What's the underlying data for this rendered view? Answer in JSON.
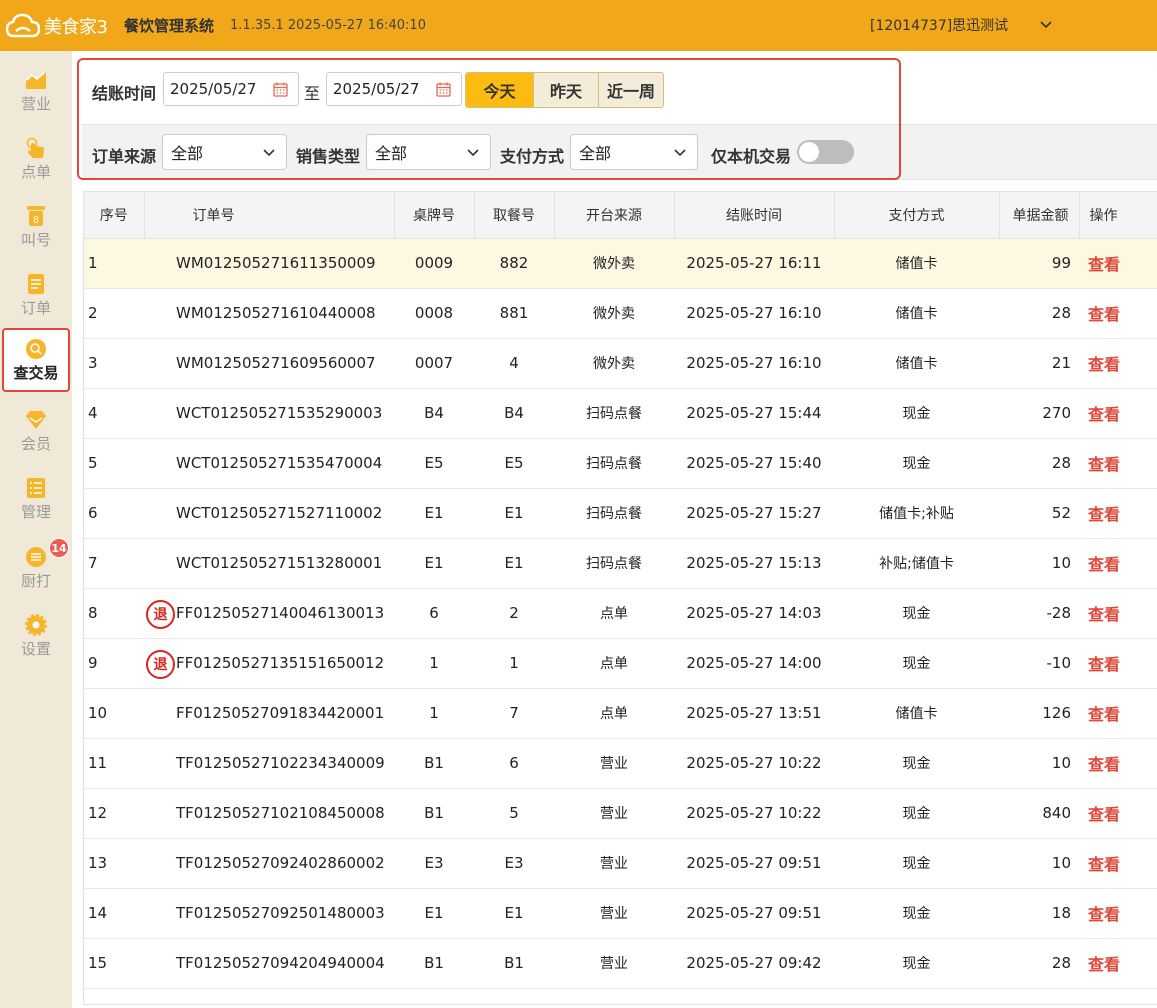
{
  "header": {
    "logo_text": "美食家3",
    "app_title": "餐饮管理系统",
    "version": "1.1.35.1 2025-05-27 16:40:10",
    "user": "[12014737]思迅测试"
  },
  "sidebar": {
    "items": [
      {
        "label": "营业",
        "icon": "chart-icon"
      },
      {
        "label": "点单",
        "icon": "hand-icon"
      },
      {
        "label": "叫号",
        "icon": "number-icon"
      },
      {
        "label": "订单",
        "icon": "list-icon"
      },
      {
        "label": "查交易",
        "icon": "search-icon",
        "active": true
      },
      {
        "label": "会员",
        "icon": "diamond-icon"
      },
      {
        "label": "管理",
        "icon": "clipboard-icon"
      },
      {
        "label": "厨打",
        "icon": "print-icon",
        "badge": "14"
      },
      {
        "label": "设置",
        "icon": "gear-icon"
      }
    ]
  },
  "filters": {
    "checkout_time_label": "结账时间",
    "date_from": "2025/05/27",
    "to_label": "至",
    "date_to": "2025/05/27",
    "quick_ranges": [
      "今天",
      "昨天",
      "近一周"
    ],
    "order_source_label": "订单来源",
    "order_source_value": "全部",
    "sale_type_label": "销售类型",
    "sale_type_value": "全部",
    "pay_method_label": "支付方式",
    "pay_method_value": "全部",
    "local_only_label": "仅本机交易",
    "local_only": false
  },
  "table": {
    "columns": [
      "序号",
      "订单号",
      "桌牌号",
      "取餐号",
      "开台来源",
      "结账时间",
      "支付方式",
      "单据金额",
      "操作"
    ],
    "action_label": "查看",
    "refund_label": "退",
    "rows": [
      {
        "no": "1",
        "order": "WM012505271611350009",
        "table": "0009",
        "pickup": "882",
        "source": "微外卖",
        "time": "2025-05-27 16:11",
        "pay": "储值卡",
        "amount": "99",
        "refund": false
      },
      {
        "no": "2",
        "order": "WM012505271610440008",
        "table": "0008",
        "pickup": "881",
        "source": "微外卖",
        "time": "2025-05-27 16:10",
        "pay": "储值卡",
        "amount": "28",
        "refund": false
      },
      {
        "no": "3",
        "order": "WM012505271609560007",
        "table": "0007",
        "pickup": "4",
        "source": "微外卖",
        "time": "2025-05-27 16:10",
        "pay": "储值卡",
        "amount": "21",
        "refund": false
      },
      {
        "no": "4",
        "order": "WCT012505271535290003",
        "table": "B4",
        "pickup": "B4",
        "source": "扫码点餐",
        "time": "2025-05-27 15:44",
        "pay": "现金",
        "amount": "270",
        "refund": false
      },
      {
        "no": "5",
        "order": "WCT012505271535470004",
        "table": "E5",
        "pickup": "E5",
        "source": "扫码点餐",
        "time": "2025-05-27 15:40",
        "pay": "现金",
        "amount": "28",
        "refund": false
      },
      {
        "no": "6",
        "order": "WCT012505271527110002",
        "table": "E1",
        "pickup": "E1",
        "source": "扫码点餐",
        "time": "2025-05-27 15:27",
        "pay": "储值卡;补贴",
        "amount": "52",
        "refund": false
      },
      {
        "no": "7",
        "order": "WCT012505271513280001",
        "table": "E1",
        "pickup": "E1",
        "source": "扫码点餐",
        "time": "2025-05-27 15:13",
        "pay": "补贴;储值卡",
        "amount": "10",
        "refund": false
      },
      {
        "no": "8",
        "order": "FF012505271400461300​13",
        "table": "6",
        "pickup": "2",
        "source": "点单",
        "time": "2025-05-27 14:03",
        "pay": "现金",
        "amount": "-28",
        "refund": true
      },
      {
        "no": "9",
        "order": "FF01250527135151650012",
        "table": "1",
        "pickup": "1",
        "source": "点单",
        "time": "2025-05-27 14:00",
        "pay": "现金",
        "amount": "-10",
        "refund": true
      },
      {
        "no": "10",
        "order": "FF01250527091834420001",
        "table": "1",
        "pickup": "7",
        "source": "点单",
        "time": "2025-05-27 13:51",
        "pay": "储值卡",
        "amount": "126",
        "refund": false
      },
      {
        "no": "11",
        "order": "TF01250527102234340009",
        "table": "B1",
        "pickup": "6",
        "source": "营业",
        "time": "2025-05-27 10:22",
        "pay": "现金",
        "amount": "10",
        "refund": false
      },
      {
        "no": "12",
        "order": "TF01250527102108450008",
        "table": "B1",
        "pickup": "5",
        "source": "营业",
        "time": "2025-05-27 10:22",
        "pay": "现金",
        "amount": "840",
        "refund": false
      },
      {
        "no": "13",
        "order": "TF01250527092402860002",
        "table": "E3",
        "pickup": "E3",
        "source": "营业",
        "time": "2025-05-27 09:51",
        "pay": "现金",
        "amount": "10",
        "refund": false
      },
      {
        "no": "14",
        "order": "TF01250527092501480003",
        "table": "E1",
        "pickup": "E1",
        "source": "营业",
        "time": "2025-05-27 09:51",
        "pay": "现金",
        "amount": "18",
        "refund": false
      },
      {
        "no": "15",
        "order": "TF01250527094204940004",
        "table": "B1",
        "pickup": "B1",
        "source": "营业",
        "time": "2025-05-27 09:42",
        "pay": "现金",
        "amount": "28",
        "refund": false
      }
    ]
  }
}
